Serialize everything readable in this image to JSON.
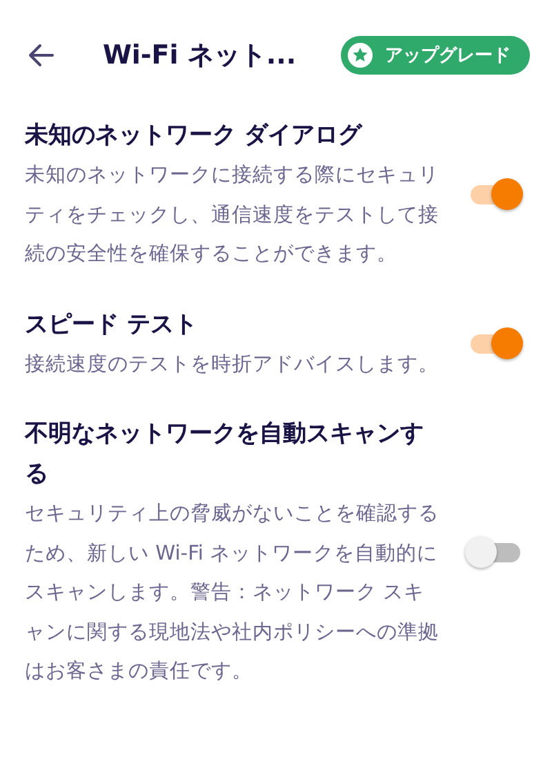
{
  "header": {
    "title": "Wi-Fi ネット...",
    "upgrade_label": "アップグレード"
  },
  "settings": [
    {
      "title": "未知のネットワーク ダイアログ",
      "description": "未知のネットワークに接続する際にセキュリティをチェックし、通信速度をテストして接続の安全性を確保することができます。",
      "on": true
    },
    {
      "title": "スピード テスト",
      "description": "接続速度のテストを時折アドバイスします。",
      "on": true
    },
    {
      "title": "不明なネットワークを自動スキャンする",
      "description": "セキュリティ上の脅威がないことを確認するため、新しい Wi-Fi ネットワークを自動的にスキャンします。警告：ネットワーク スキャンに関する現地法や社内ポリシーへの準拠はお客さまの責任です。",
      "on": false
    }
  ]
}
